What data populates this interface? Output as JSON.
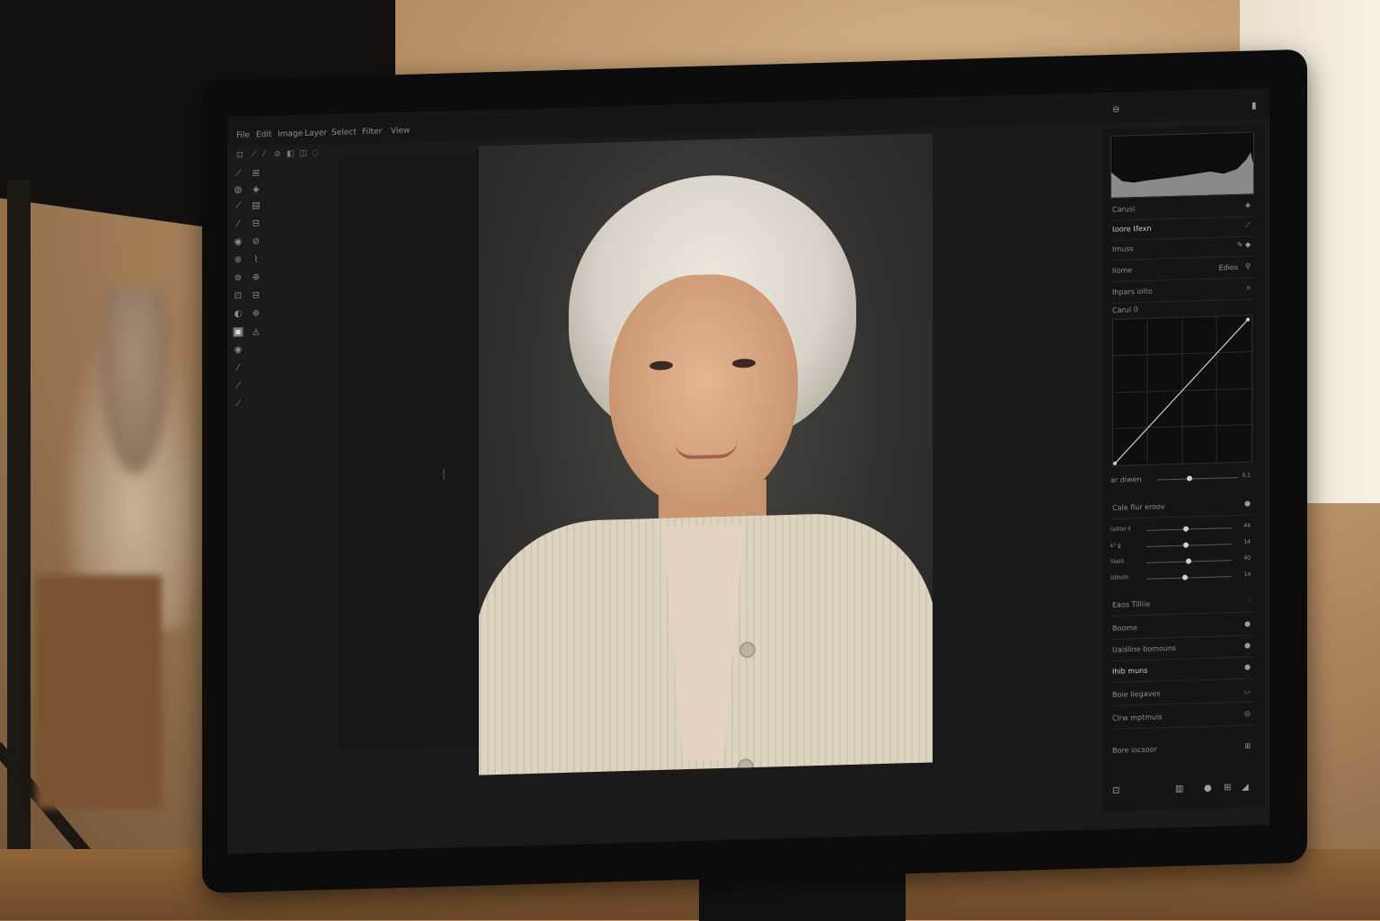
{
  "app": {
    "menu": [
      "File",
      "Edit",
      "Image",
      "Layer",
      "Select",
      "Filter",
      "View"
    ],
    "top_icons": [
      "eye-icon",
      "menu-dots-icon"
    ]
  },
  "right_panel": {
    "header_rows": [
      {
        "label": "Carusl",
        "icon": "◈"
      },
      {
        "label": "Ɩoore Ɩfexn",
        "icon": "⟋"
      },
      {
        "label": "Imuss",
        "icon": "✎ ◆"
      },
      {
        "label": "Iiome",
        "value": "Edios",
        "icon": "⚲"
      },
      {
        "label": "Ihpars iolto",
        "icon": "⌗"
      }
    ],
    "curve_label": "Carul 0",
    "curve_slider_label": "ar diwen",
    "curve_slider_value": "0.1",
    "section_title": "Cale flur eroov",
    "sliders": [
      {
        "label": "lailllal ll",
        "value": "44",
        "position": 0.45
      },
      {
        "label": "k² ǥ",
        "value": "14",
        "position": 0.45
      },
      {
        "label": "lllwlll",
        "value": "40",
        "position": 0.48
      },
      {
        "label": "Dlllollll",
        "value": "1a",
        "position": 0.44
      }
    ],
    "footer_rows": [
      {
        "label": "Eaos Tilliie",
        "icon": "·"
      },
      {
        "label": "Boome",
        "icon": "●"
      },
      {
        "label": "Uaiśline bomouns",
        "icon": "●"
      },
      {
        "label": "Ihib muns",
        "icon": "●"
      },
      {
        "label": "Boie Iiegaves",
        "icon": "◡"
      },
      {
        "label": "Clrw mptmuis",
        "icon": "◎"
      },
      {
        "label": "Bore iocsoor",
        "icon": "⊞"
      }
    ],
    "bottom_icons": [
      "⊡",
      "▥",
      "●",
      "⊞",
      "◢"
    ]
  },
  "colors": {
    "app_bg": "#1a1a1a",
    "panel_bg": "#151515",
    "text": "#8f8f8f"
  }
}
